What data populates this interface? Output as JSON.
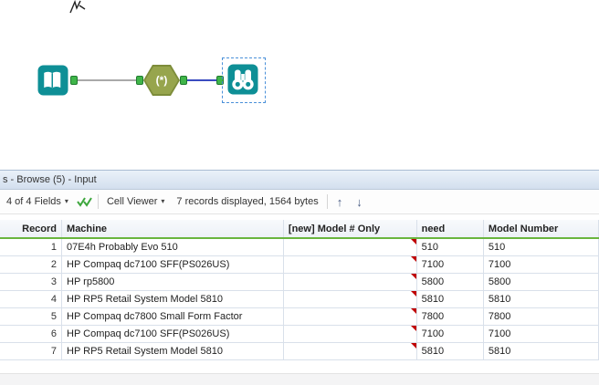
{
  "icons": {
    "caret": "▾",
    "regex_glyph": "(*)",
    "up_arrow": "↑",
    "down_arrow": "↓",
    "input_tool": "open-book",
    "browse_tool": "binoculars",
    "apply_check": "double-checkmark"
  },
  "colors": {
    "tool_teal": "#0E8F96",
    "regex_olive": "#97A54D",
    "anchor_green": "#3FB549",
    "selected_connection_blue": "#3B4CC0",
    "header_underline_green": "#69B53E",
    "warning_red": "#C00000"
  },
  "results": {
    "title": "s - Browse (5) - Input",
    "toolbar": {
      "fields": "4 of 4 Fields",
      "cell_viewer": "Cell Viewer",
      "records": "7 records displayed, 1564 bytes"
    },
    "table": {
      "columns": [
        "Record",
        "Machine",
        "[new] Model # Only",
        "need",
        "Model Number"
      ],
      "rows": [
        [
          "1",
          "07E4h Probably Evo 510",
          "",
          "510",
          "510"
        ],
        [
          "2",
          "HP Compaq dc7100 SFF(PS026US)",
          "",
          "7100",
          "7100"
        ],
        [
          "3",
          "HP rp5800",
          "",
          "5800",
          "5800"
        ],
        [
          "4",
          "HP RP5 Retail System Model 5810",
          "",
          "5810",
          "5810"
        ],
        [
          "5",
          "HP Compaq dc7800 Small Form Factor",
          "",
          "7800",
          "7800"
        ],
        [
          "6",
          "HP Compaq dc7100 SFF(PS026US)",
          "",
          "7100",
          "7100"
        ],
        [
          "7",
          "HP RP5 Retail System Model 5810",
          "",
          "5810",
          "5810"
        ]
      ]
    }
  }
}
